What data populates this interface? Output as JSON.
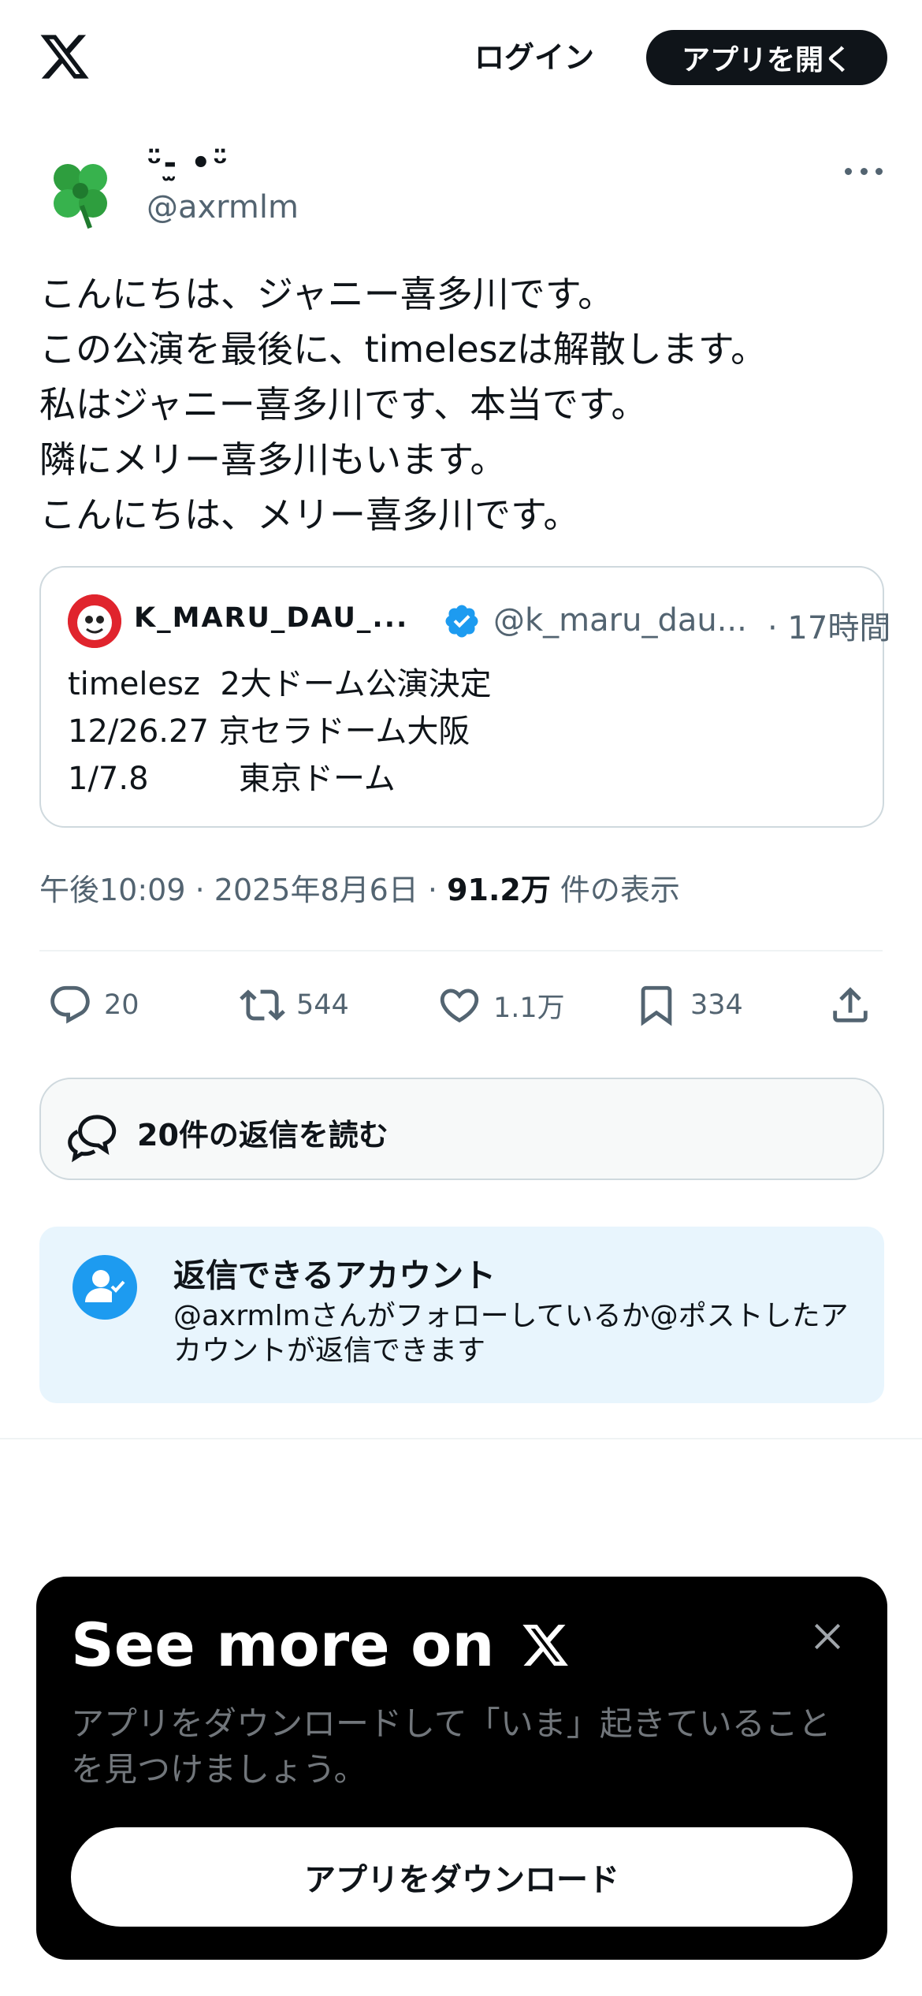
{
  "header": {
    "logo_icon": "x-logo-icon",
    "login_label": "ログイン",
    "open_app_label": "アプリを開く"
  },
  "post": {
    "author_display_name": "ᵕ̈-̫ •ᵕ̈",
    "author_handle": "@axrmlm",
    "avatar_icon": "four-leaf-clover-icon",
    "more_icon": "more-dots-icon",
    "text_lines": [
      "こんにちは、ジャニー喜多川です。",
      "この公演を最後に、timeleszは解散します。",
      "私はジャニー喜多川です、本当です。",
      "隣にメリー喜多川もいます。",
      "こんにちは、メリー喜多川です。"
    ],
    "quote": {
      "display_name": "K_MARU_DAU_...",
      "verified_icon": "verified-badge-icon",
      "handle": "@k_maru_dau...",
      "time": "· 17時間",
      "lines": [
        "timelesz  2大ドーム公演決定",
        "12/26.27 京セラドーム大阪",
        "1/7.8         東京ドーム"
      ]
    },
    "meta": {
      "time": "午後10:09",
      "separator": " · ",
      "date": "2025年8月6日",
      "views_count": "91.2万",
      "views_label": " 件の表示"
    },
    "actions": {
      "reply": {
        "icon": "reply-icon",
        "count": "20"
      },
      "repost": {
        "icon": "repost-icon",
        "count": "544"
      },
      "like": {
        "icon": "heart-icon",
        "count": "1.1万"
      },
      "bookmark": {
        "icon": "bookmark-icon",
        "count": "334"
      },
      "share": {
        "icon": "share-icon"
      }
    },
    "read_replies_label": "20件の返信を読む",
    "who_can_reply": {
      "title": "返信できるアカウント",
      "description": "@axrmlmさんがフォローしているか@ポストしたアカウントが返信できます"
    }
  },
  "promo": {
    "title": "See more on",
    "description": "アプリをダウンロードして「いま」起きていることを見つけましょう。",
    "download_label": "アプリをダウンロード",
    "close_icon": "close-icon"
  },
  "colors": {
    "text_primary": "#0f1419",
    "text_secondary": "#536471",
    "accent_blue": "#1d9bf0",
    "border": "#cfd9de",
    "info_bg": "#e8f5fd",
    "promo_bg": "#000000"
  }
}
